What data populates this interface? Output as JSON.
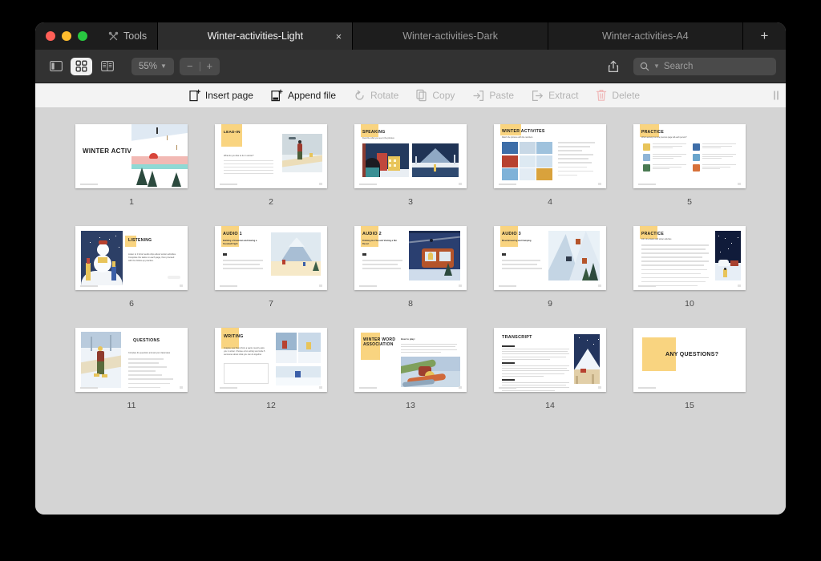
{
  "window": {
    "traffic_lights": [
      "close",
      "minimize",
      "zoom"
    ],
    "tools_label": "Tools",
    "add_tab_label": "+",
    "close_tab_label": "×"
  },
  "tabs": [
    {
      "label": "Winter-activities-Light",
      "active": true
    },
    {
      "label": "Winter-activities-Dark",
      "active": false
    },
    {
      "label": "Winter-activities-A4",
      "active": false
    }
  ],
  "toolbar": {
    "view_modes": [
      {
        "name": "sidebar-view",
        "selected": false
      },
      {
        "name": "grid-view",
        "selected": true
      },
      {
        "name": "two-page-view",
        "selected": false
      }
    ],
    "zoom_level": "55%",
    "zoom_out_label": "−",
    "zoom_in_label": "+",
    "share_icon": "share-icon",
    "search_placeholder": "Search"
  },
  "actions": [
    {
      "label": "Insert page",
      "icon": "insert-page-icon",
      "enabled": true
    },
    {
      "label": "Append file",
      "icon": "append-file-icon",
      "enabled": true
    },
    {
      "label": "Rotate",
      "icon": "rotate-icon",
      "enabled": false
    },
    {
      "label": "Copy",
      "icon": "copy-icon",
      "enabled": false
    },
    {
      "label": "Paste",
      "icon": "paste-icon",
      "enabled": false
    },
    {
      "label": "Extract",
      "icon": "extract-icon",
      "enabled": false
    },
    {
      "label": "Delete",
      "icon": "trash-icon",
      "enabled": false
    }
  ],
  "colors": {
    "accent_yellow": "#f9d480",
    "window_chrome": "#323232",
    "tab_active": "#2d2d2d",
    "canvas": "#d4d4d4",
    "red": "#ff5f57",
    "yellow": "#febc2e",
    "green": "#28c840"
  },
  "pages": [
    {
      "number": "1",
      "title": "WINTER ACTIVITIES",
      "subtitle": "",
      "layout": "title-hero"
    },
    {
      "number": "2",
      "title": "LEAD-IN",
      "subtitle": "What do you like to do in winter?",
      "layout": "prompt-lines"
    },
    {
      "number": "3",
      "title": "SPEAKING",
      "subtitle": "Describe what you see in the pictures",
      "layout": "two-images"
    },
    {
      "number": "4",
      "title": "WINTER ACTIVITES",
      "subtitle": "Match the pictures with the numbers",
      "layout": "photo-grid"
    },
    {
      "number": "5",
      "title": "PRACTICE",
      "subtitle": "Which activity from the previous page will each person?",
      "layout": "avatar-list"
    },
    {
      "number": "6",
      "title": "LISTENING",
      "subtitle": "Listen to 3 short audio clips about winter activities. Complete the tasks on each page, then proceed with the follow-up practice.",
      "layout": "image-left-text"
    },
    {
      "number": "7",
      "title": "AUDIO 1",
      "subtitle": "Building a Snowman and Having a Snowball Fight",
      "layout": "audio-questions"
    },
    {
      "number": "8",
      "title": "AUDIO 2",
      "subtitle": "Drinking Hot Tea and Visiting a Ski Resort",
      "layout": "audio-questions"
    },
    {
      "number": "9",
      "title": "AUDIO 3",
      "subtitle": "Mountaineering and Camping",
      "layout": "audio-questions"
    },
    {
      "number": "10",
      "title": "PRACTICE",
      "subtitle": "Fill in the blanks with winter activities",
      "layout": "fill-blanks"
    },
    {
      "number": "11",
      "title": "QUESTIONS",
      "subtitle": "Complete the questions and ask your classmates",
      "layout": "questions"
    },
    {
      "number": "12",
      "title": "WRITING",
      "subtitle": "Imagine your friend from a warm country asks you in winter. Choose a fun activity and write 5 sentences about what you can do together.",
      "layout": "writing-box"
    },
    {
      "number": "13",
      "title": "WINTER WORD ASSOCIATION",
      "subtitle": "How to play:",
      "layout": "word-game"
    },
    {
      "number": "14",
      "title": "TRANSCRIPT",
      "subtitle": "",
      "layout": "transcript"
    },
    {
      "number": "15",
      "title": "ANY QUESTIONS?",
      "subtitle": "",
      "layout": "closing"
    }
  ]
}
